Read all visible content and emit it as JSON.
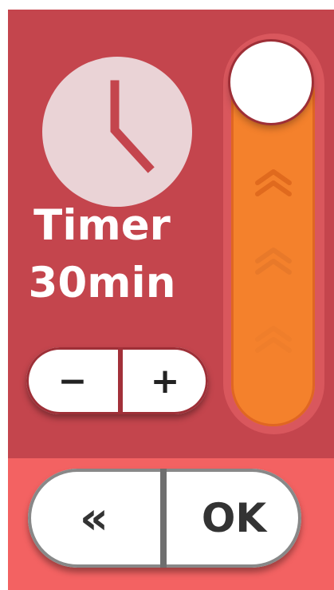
{
  "timer": {
    "label": "Timer",
    "value": "30min"
  },
  "stepper": {
    "minus_label": "−",
    "plus_label": "+"
  },
  "slider": {
    "level": 1.0
  },
  "actions": {
    "back_label": "«",
    "ok_label": "OK"
  },
  "icons": {
    "clock": "clock-icon",
    "chevron": "double-chevron-up-icon"
  },
  "colors": {
    "panel": "#c4454d",
    "footer": "#f36262",
    "track": "#f4812c",
    "clock_face": "#ead3d6"
  }
}
